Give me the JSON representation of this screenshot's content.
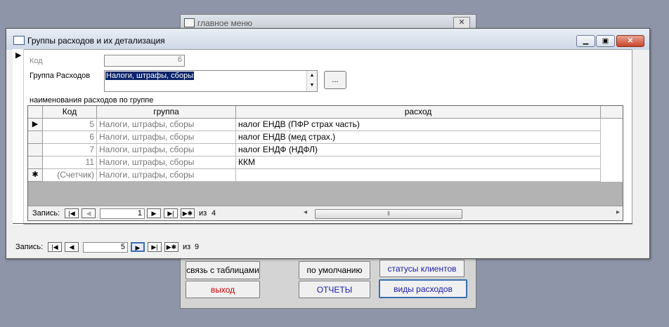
{
  "main_menu": {
    "title": "главное меню",
    "close_glyph": "✕",
    "buttons": {
      "link_table": "связь с таблицами",
      "exit": "выход",
      "default": "по умолчанию",
      "reports": "ОТЧЕТЫ",
      "client_statuses": "статусы клиентов",
      "expense_types": "виды расходов"
    }
  },
  "window": {
    "title": "Группы расходов и их детализация",
    "minimize_glyph": "▁",
    "restore_glyph": "▣",
    "close_glyph": "✕"
  },
  "form": {
    "code_label": "Код",
    "code_value": "6",
    "group_label": "Группа Расходов",
    "group_value": "Налоги, штрафы, сборы",
    "lookup_button": "...",
    "subform_caption": "наименования расходов по группе"
  },
  "grid": {
    "columns": [
      "Код",
      "группа",
      "расход"
    ],
    "rows": [
      {
        "code": "5",
        "group": "Налоги, штрафы, сборы",
        "expense": "налог ЕНДВ (ПФР страх часть)"
      },
      {
        "code": "6",
        "group": "Налоги, штрафы, сборы",
        "expense": "налог ЕНДВ (мед страх.)"
      },
      {
        "code": "7",
        "group": "Налоги, штрафы, сборы",
        "expense": "налог ЕНДФ (НДФЛ)"
      },
      {
        "code": "11",
        "group": "Налоги, штрафы, сборы",
        "expense": "ККМ"
      }
    ],
    "new_row": {
      "code": "(Счетчик)",
      "group": "Налоги, штрафы, сборы",
      "expense": ""
    },
    "new_row_marker": "✱",
    "current_marker": "▶"
  },
  "sub_nav": {
    "label": "Запись:",
    "current": "1",
    "of_label": "из",
    "total": "4",
    "first": "|◀",
    "prev": "◀",
    "next": "▶",
    "last": "▶|",
    "new": "▶✱",
    "scroll_left": "◂",
    "scroll_right": "▸",
    "thumb_grip": "⦀"
  },
  "main_nav": {
    "label": "Запись:",
    "current": "5",
    "of_label": "из",
    "total": "9",
    "first": "|◀",
    "prev": "◀",
    "next": "▶",
    "last": "▶|",
    "new": "▶✱"
  },
  "form_marker": "▶",
  "colors": {
    "desktop": "#8f95a8",
    "selection": "#0a246a",
    "exit_text": "#cc0000",
    "link_text": "#1a1aa8"
  }
}
